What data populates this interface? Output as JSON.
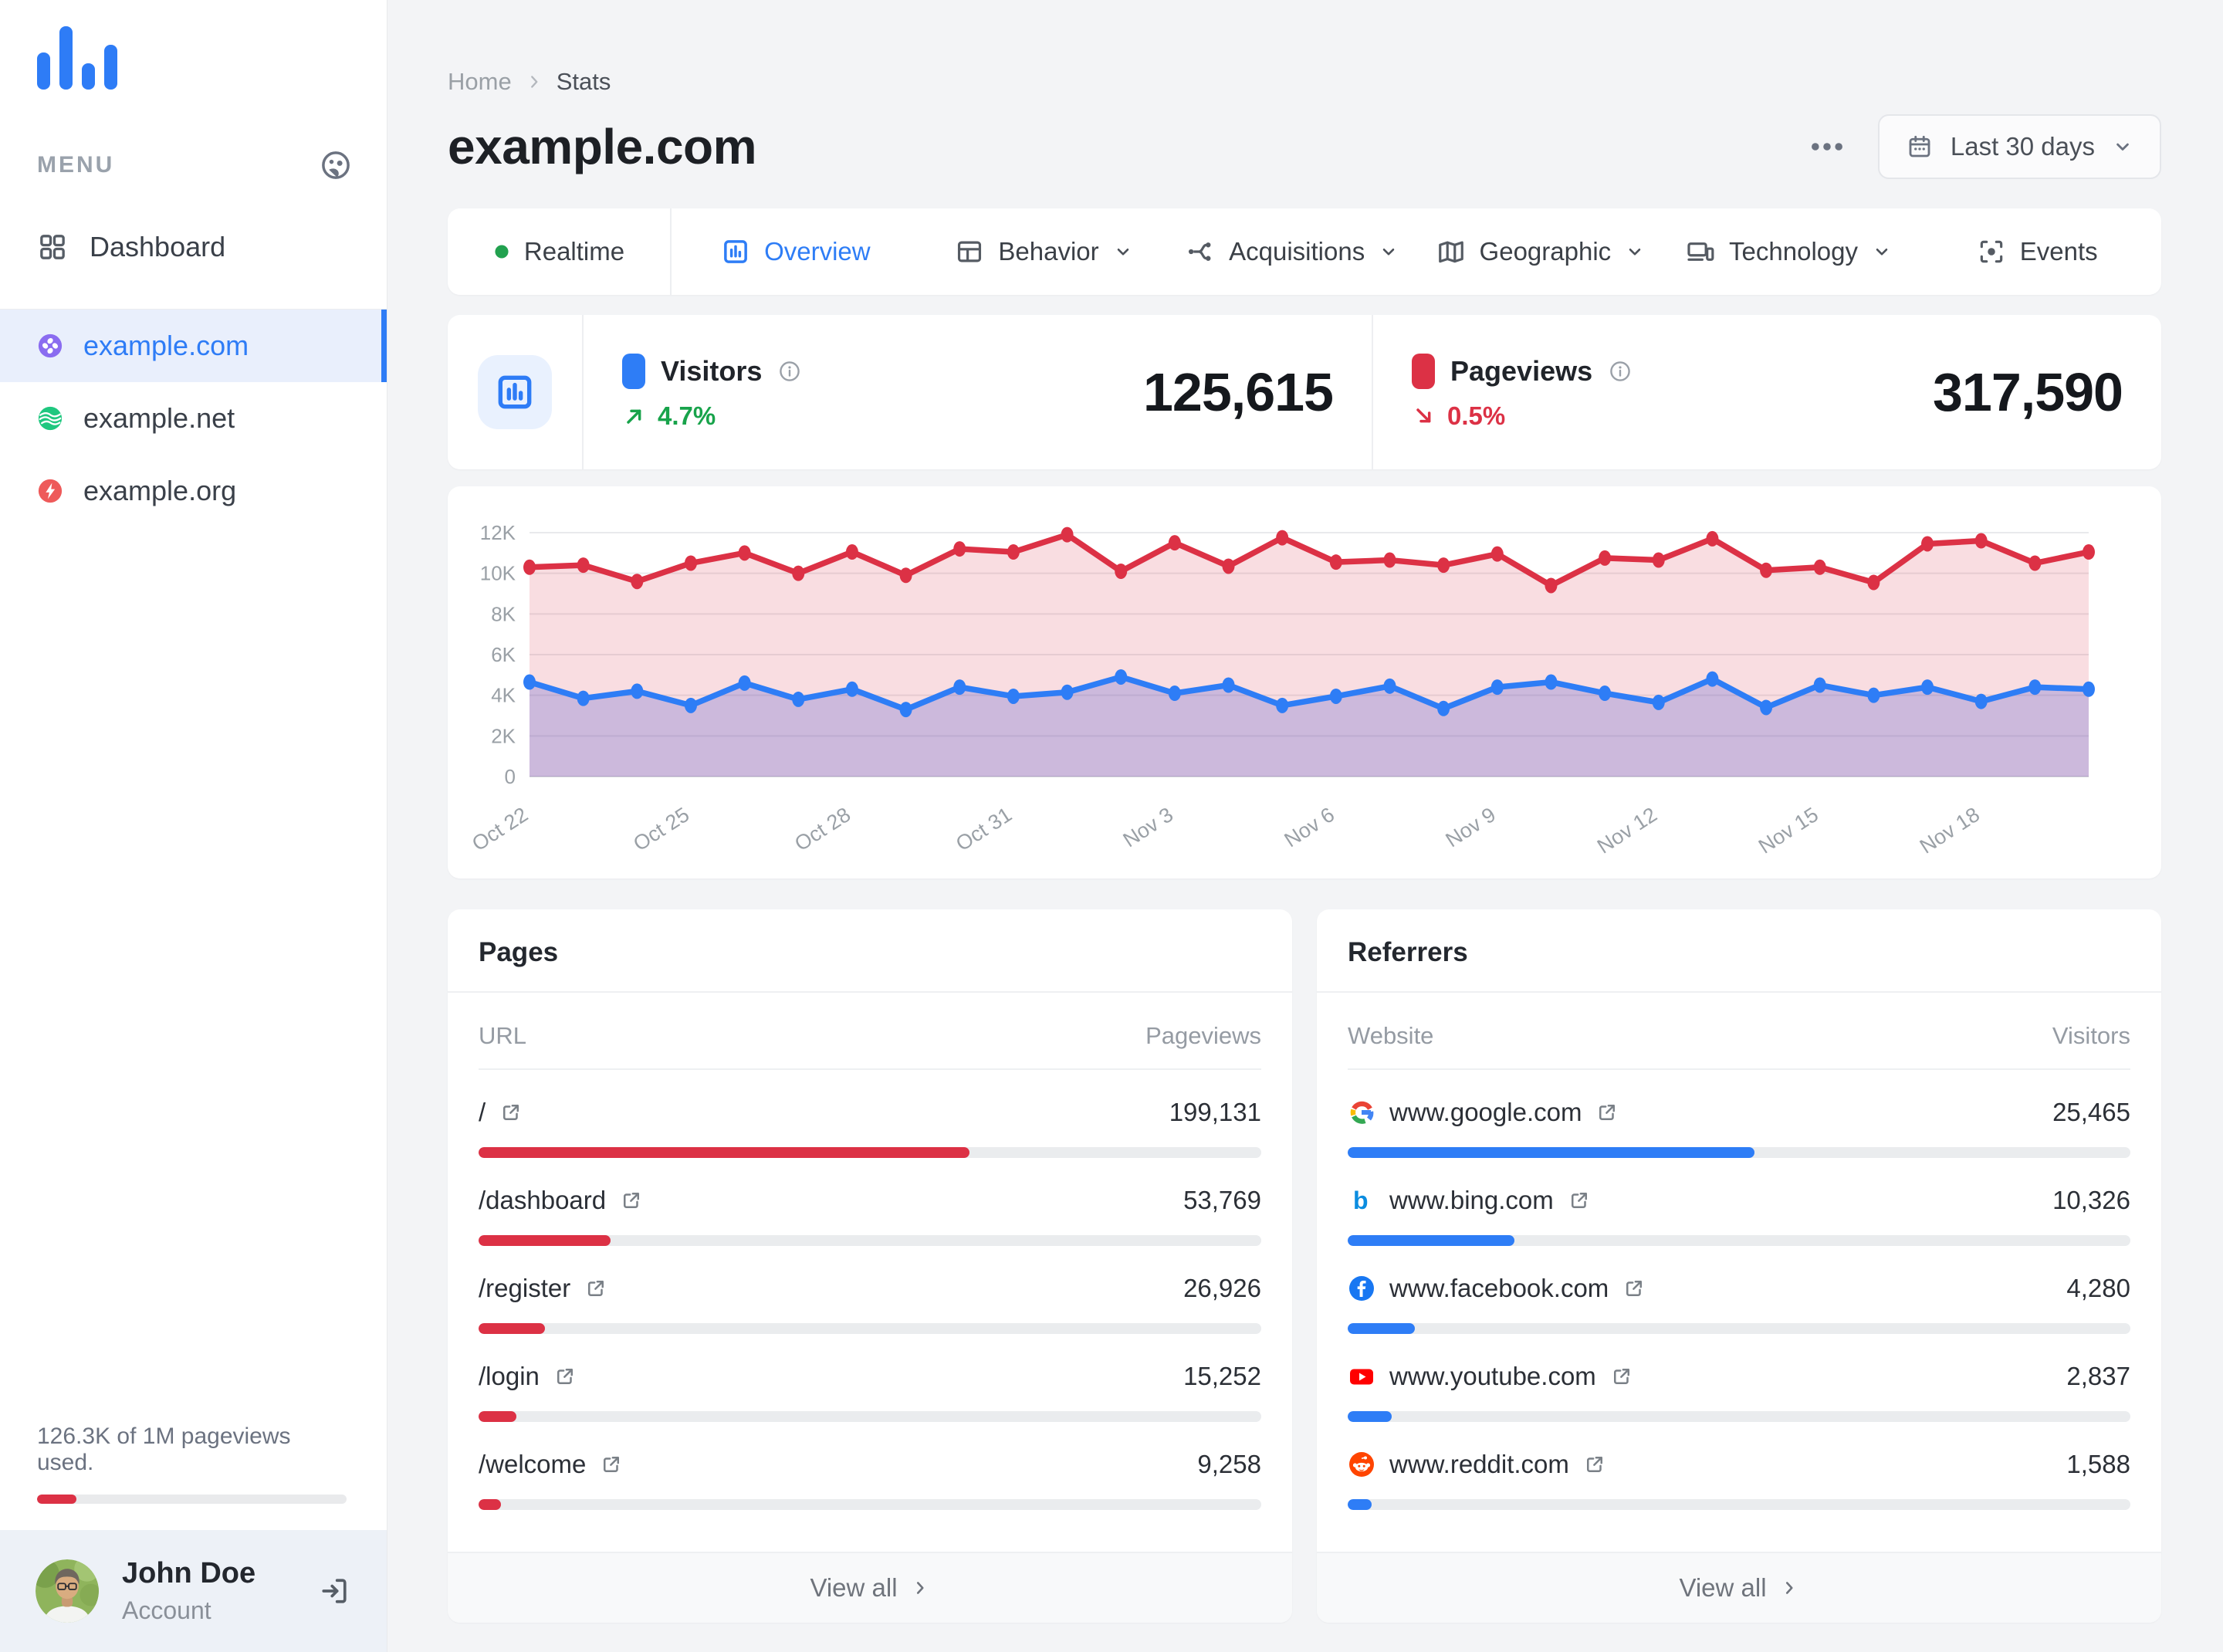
{
  "sidebar": {
    "menu_label": "MENU",
    "nav": [
      {
        "label": "Dashboard",
        "icon": "grid-icon"
      }
    ],
    "sites": [
      {
        "label": "example.com",
        "icon": "site-com-icon",
        "color": "#8a6cf0",
        "active": true
      },
      {
        "label": "example.net",
        "icon": "site-net-icon",
        "color": "#1fc77f",
        "active": false
      },
      {
        "label": "example.org",
        "icon": "site-org-icon",
        "color": "#ee5a5a",
        "active": false
      }
    ],
    "usage": {
      "text": "126.3K of 1M pageviews used.",
      "percent": 12.6
    },
    "account": {
      "name": "John Doe",
      "role": "Account"
    }
  },
  "header": {
    "breadcrumb": [
      "Home",
      "Stats"
    ],
    "title": "example.com",
    "date_range": "Last 30 days"
  },
  "tabs": [
    {
      "label": "Realtime",
      "icon": "realtime-dot-icon",
      "active": false,
      "chevron": false,
      "segment": true
    },
    {
      "label": "Overview",
      "icon": "overview-icon",
      "active": true,
      "chevron": false,
      "segment": false
    },
    {
      "label": "Behavior",
      "icon": "behavior-icon",
      "active": false,
      "chevron": true,
      "segment": false
    },
    {
      "label": "Acquisitions",
      "icon": "acquisitions-icon",
      "active": false,
      "chevron": true,
      "segment": false
    },
    {
      "label": "Geographic",
      "icon": "geographic-icon",
      "active": false,
      "chevron": true,
      "segment": false
    },
    {
      "label": "Technology",
      "icon": "technology-icon",
      "active": false,
      "chevron": true,
      "segment": false
    },
    {
      "label": "Events",
      "icon": "events-icon",
      "active": false,
      "chevron": false,
      "segment": false
    }
  ],
  "stats": {
    "visitors": {
      "label": "Visitors",
      "value": "125,615",
      "change": "4.7%",
      "direction": "up",
      "color": "#2e7df6"
    },
    "pageviews": {
      "label": "Pageviews",
      "value": "317,590",
      "change": "0.5%",
      "direction": "down",
      "color": "#dc3145"
    }
  },
  "chart_data": {
    "type": "line",
    "title": "Visitors and Pageviews, last 30 days",
    "x": [
      "Oct 22",
      "Oct 23",
      "Oct 24",
      "Oct 25",
      "Oct 26",
      "Oct 27",
      "Oct 28",
      "Oct 29",
      "Oct 30",
      "Oct 31",
      "Nov 1",
      "Nov 2",
      "Nov 3",
      "Nov 4",
      "Nov 5",
      "Nov 6",
      "Nov 7",
      "Nov 8",
      "Nov 9",
      "Nov 10",
      "Nov 11",
      "Nov 12",
      "Nov 13",
      "Nov 14",
      "Nov 15",
      "Nov 16",
      "Nov 17",
      "Nov 18",
      "Nov 19",
      "Nov 20"
    ],
    "tick_every": 3,
    "tick_labels": [
      "Oct 22",
      "Oct 25",
      "Oct 28",
      "Oct 31",
      "Nov 3",
      "Nov 6",
      "Nov 9",
      "Nov 12",
      "Nov 15",
      "Nov 18"
    ],
    "ylim": [
      0,
      12000
    ],
    "ytick_step": 2000,
    "ytick_labels": [
      "0",
      "2K",
      "4K",
      "6K",
      "8K",
      "10K",
      "12K"
    ],
    "grid": true,
    "legend_position": "none",
    "series": [
      {
        "name": "Pageviews",
        "color": "#dc3145",
        "fill": "rgba(220,46,70,0.16)",
        "values": [
          10300,
          10400,
          9600,
          10500,
          11000,
          10000,
          11050,
          9900,
          11200,
          11050,
          11900,
          10100,
          11500,
          10350,
          11750,
          10550,
          10650,
          10400,
          10950,
          9400,
          10750,
          10650,
          11700,
          10150,
          10300,
          9550,
          11450,
          11600,
          10500,
          11050
        ]
      },
      {
        "name": "Visitors",
        "color": "#2e7df6",
        "fill": "rgba(98,102,208,0.30)",
        "values": [
          4650,
          3850,
          4200,
          3500,
          4600,
          3800,
          4300,
          3300,
          4400,
          3950,
          4150,
          4900,
          4100,
          4500,
          3500,
          3950,
          4450,
          3350,
          4400,
          4650,
          4100,
          3650,
          4800,
          3400,
          4500,
          4000,
          4400,
          3700,
          4400,
          4300
        ]
      }
    ]
  },
  "pages": {
    "title": "Pages",
    "columns": [
      "URL",
      "Pageviews"
    ],
    "bar_color": "#dc3145",
    "rows": [
      {
        "label": "/",
        "value": "199,131",
        "percent": 62.7
      },
      {
        "label": "/dashboard",
        "value": "53,769",
        "percent": 16.9
      },
      {
        "label": "/register",
        "value": "26,926",
        "percent": 8.5
      },
      {
        "label": "/login",
        "value": "15,252",
        "percent": 4.8
      },
      {
        "label": "/welcome",
        "value": "9,258",
        "percent": 2.9
      }
    ],
    "view_all": "View all"
  },
  "referrers": {
    "title": "Referrers",
    "columns": [
      "Website",
      "Visitors"
    ],
    "bar_color": "#2e7df6",
    "rows": [
      {
        "label": "www.google.com",
        "icon": "google-favicon",
        "value": "25,465",
        "percent": 52.0
      },
      {
        "label": "www.bing.com",
        "icon": "bing-favicon",
        "value": "10,326",
        "percent": 21.3
      },
      {
        "label": "www.facebook.com",
        "icon": "facebook-favicon",
        "value": "4,280",
        "percent": 8.6
      },
      {
        "label": "www.youtube.com",
        "icon": "youtube-favicon",
        "value": "2,837",
        "percent": 5.6
      },
      {
        "label": "www.reddit.com",
        "icon": "reddit-favicon",
        "value": "1,588",
        "percent": 3.1
      }
    ],
    "view_all": "View all"
  }
}
